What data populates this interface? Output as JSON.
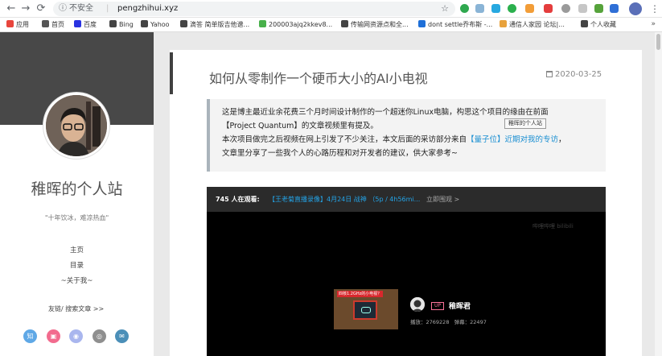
{
  "browser": {
    "security_label": "不安全",
    "url": "pengzhihui.xyz",
    "bookmarks": [
      {
        "label": "应用",
        "icon": "apps-grid-icon",
        "color": "#e8453c"
      },
      {
        "label": "首页",
        "icon": "bookmark-icon",
        "color": "#555555"
      },
      {
        "label": "百度",
        "icon": "baidu-icon",
        "color": "#2932e1"
      },
      {
        "label": "Bing",
        "icon": "globe-icon",
        "color": "#444444"
      },
      {
        "label": "Yahoo",
        "icon": "globe-icon",
        "color": "#444444"
      },
      {
        "label": "滴答 简单版吉他谱...",
        "icon": "globe-icon",
        "color": "#444444"
      },
      {
        "label": "200003ajq2kkev8...",
        "icon": "site-17-icon",
        "color": "#48b04a"
      },
      {
        "label": "传输网资源点和全...",
        "icon": "globe-icon",
        "color": "#444444"
      },
      {
        "label": "dont settle乔布斯 -...",
        "icon": "cd-icon",
        "color": "#1e6fd8"
      },
      {
        "label": "通信人家园 论坛|...",
        "icon": "chrome-icon",
        "color": "#e8a23c"
      },
      {
        "label": "个人收藏",
        "icon": "globe-icon",
        "color": "#444444"
      }
    ],
    "bookmarks_more": "»"
  },
  "sidebar": {
    "site_title": "稚晖的个人站",
    "motto": "\"十年饮冰，难凉热血\"",
    "links": [
      "主页",
      "目录",
      "~关于我~"
    ],
    "friend_link": "友链/ 搜索文章 >>",
    "socials": [
      {
        "name": "zhihu-icon",
        "glyph": "知",
        "color": "#5fa8e6"
      },
      {
        "name": "bilibili-icon",
        "glyph": "▣",
        "color": "#f26b8e"
      },
      {
        "name": "weibo-icon",
        "glyph": "◉",
        "color": "#a9b6ee"
      },
      {
        "name": "github-icon",
        "glyph": "◎",
        "color": "#8f8f8f"
      },
      {
        "name": "mail-icon",
        "glyph": "✉",
        "color": "#4b8fb8"
      }
    ]
  },
  "post": {
    "title": "如何从零制作一个硬币大小的AI小电视",
    "date": "2020-03-25",
    "intro_line1": "这是博主最近业余花费三个月时间设计制作的一个超迷你Linux电脑，构思这个项目的缘由在前面",
    "intro_line2": "【Project Quantum】的文章视频里有提及。",
    "intro_line3_a": "本次项目做完之后视频在网上引发了不少关注，本文后面的采访部分来自",
    "intro_line3_link": "【量子位】近期对我的专访",
    "intro_line3_b": "，",
    "intro_line4": "文章里分享了一些我个人的心路历程和对开发者的建议，供大家参考~"
  },
  "tooltip": "稚晖的个人站",
  "video": {
    "viewers": "745 人在观看:",
    "live_text": "【王老菊直播录像】4月24日 战神 （5p / 4h56mi...",
    "watch_now": "立即围观 >",
    "watermark": "哔哩哔哩 bilibili",
    "thumb_banner": "四核1.2GHz的小电视？",
    "up_badge": "UP",
    "up_name": "稚晖君",
    "plays": "播放：2769228",
    "danmaku": "弹幕：22497"
  }
}
